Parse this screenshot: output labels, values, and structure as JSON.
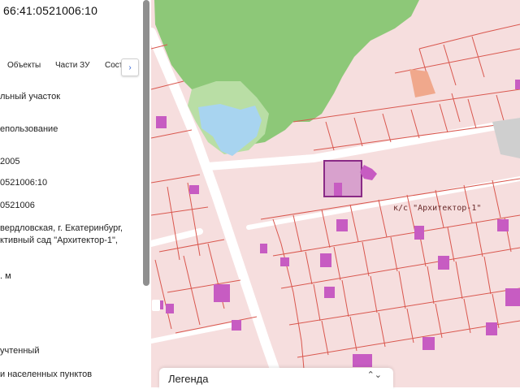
{
  "cadastral_number": "66:41:0521006:10",
  "tabs": [
    {
      "label": "Объекты"
    },
    {
      "label": "Части ЗУ"
    },
    {
      "label": "Сост"
    }
  ],
  "tab_scroll_arrow": "›",
  "fields": [
    {
      "text": "льный участок"
    },
    {
      "text": "епользование"
    },
    {
      "text": "2005"
    },
    {
      "text": "0521006:10"
    },
    {
      "text": "0521006"
    },
    {
      "text": "вердловская, г. Екатеринбург,"
    },
    {
      "text": "ктивный сад \"Архитектор-1\","
    },
    {
      "text": ". м"
    },
    {
      "text": "учтенный"
    },
    {
      "text": "и населенных пунктов"
    }
  ],
  "map": {
    "area_label": "к/с \"Архитектор-1\"",
    "legend_label": "Легенда",
    "legend_chevron": "⌃⌄"
  },
  "colors": {
    "parcel_fill": "#f6dede",
    "parcel_border": "#d9574e",
    "forest": "#8dc878",
    "forest_light": "#b9dea5",
    "water": "#a8d4f0",
    "building": "#c75cc2",
    "selected": "#8a2a86"
  }
}
